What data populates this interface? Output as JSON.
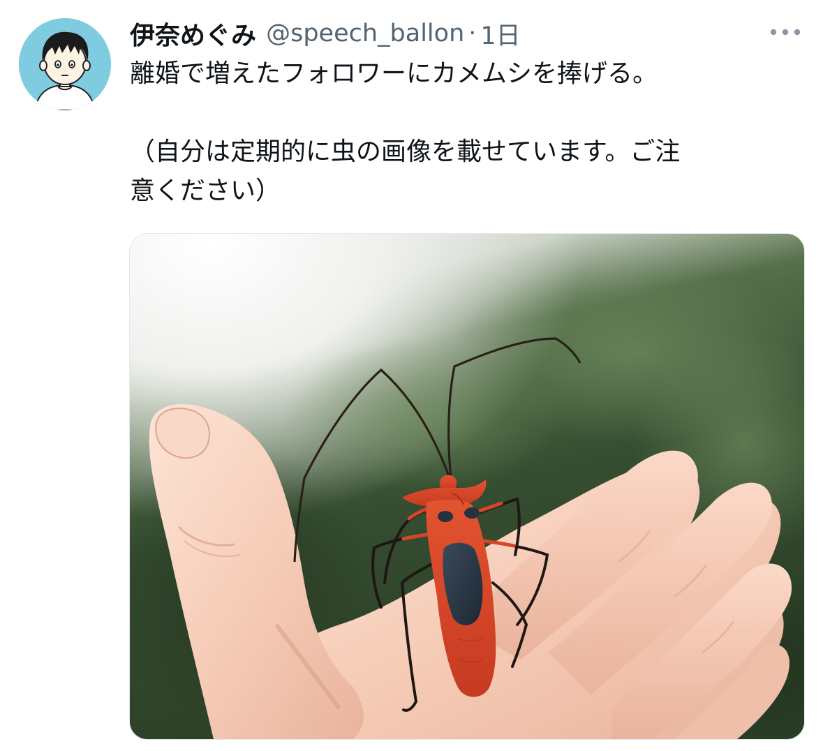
{
  "tweet": {
    "display_name": "伊奈めぐみ",
    "handle": "@speech_ballon",
    "separator": "·",
    "timestamp": "1日",
    "text_line1": "離婚で増えたフォロワーにカメムシを捧げる。",
    "text_line2": "（自分は定期的に虫の画像を載せています。ご注",
    "text_line3": "意ください）"
  },
  "icons": {
    "more": "more-horizontal-icon",
    "avatar": "cartoon-boy-avatar"
  },
  "colors": {
    "text_primary": "#0f1419",
    "text_secondary": "#536471",
    "avatar_bg": "#7fcbe0",
    "bug_red": "#d8442a",
    "bug_black": "#25323f"
  }
}
